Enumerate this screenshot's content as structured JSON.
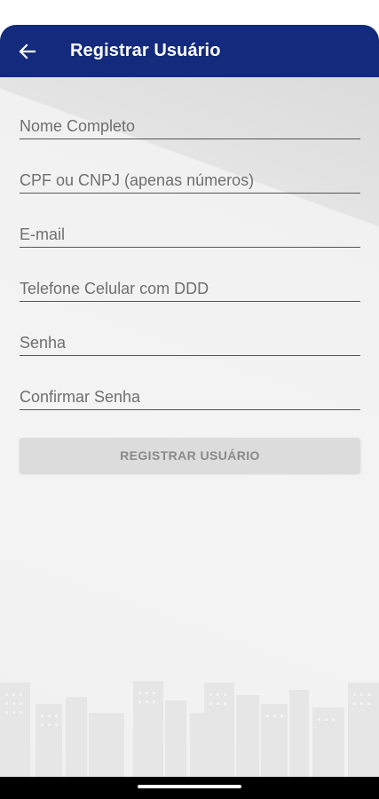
{
  "appbar": {
    "title": "Registrar Usuário",
    "back_icon": "arrow-left-icon",
    "background": "#142a7c"
  },
  "form": {
    "fields": [
      {
        "name": "full-name-field",
        "placeholder": "Nome Completo",
        "value": ""
      },
      {
        "name": "cpf-cnpj-field",
        "placeholder": "CPF ou CNPJ (apenas números)",
        "value": ""
      },
      {
        "name": "email-field",
        "placeholder": "E-mail",
        "value": ""
      },
      {
        "name": "phone-field",
        "placeholder": "Telefone Celular com DDD",
        "value": ""
      },
      {
        "name": "password-field",
        "placeholder": "Senha",
        "value": ""
      },
      {
        "name": "confirm-password-field",
        "placeholder": "Confirmar Senha",
        "value": ""
      }
    ],
    "submit_label": "REGISTRAR USUÁRIO"
  }
}
